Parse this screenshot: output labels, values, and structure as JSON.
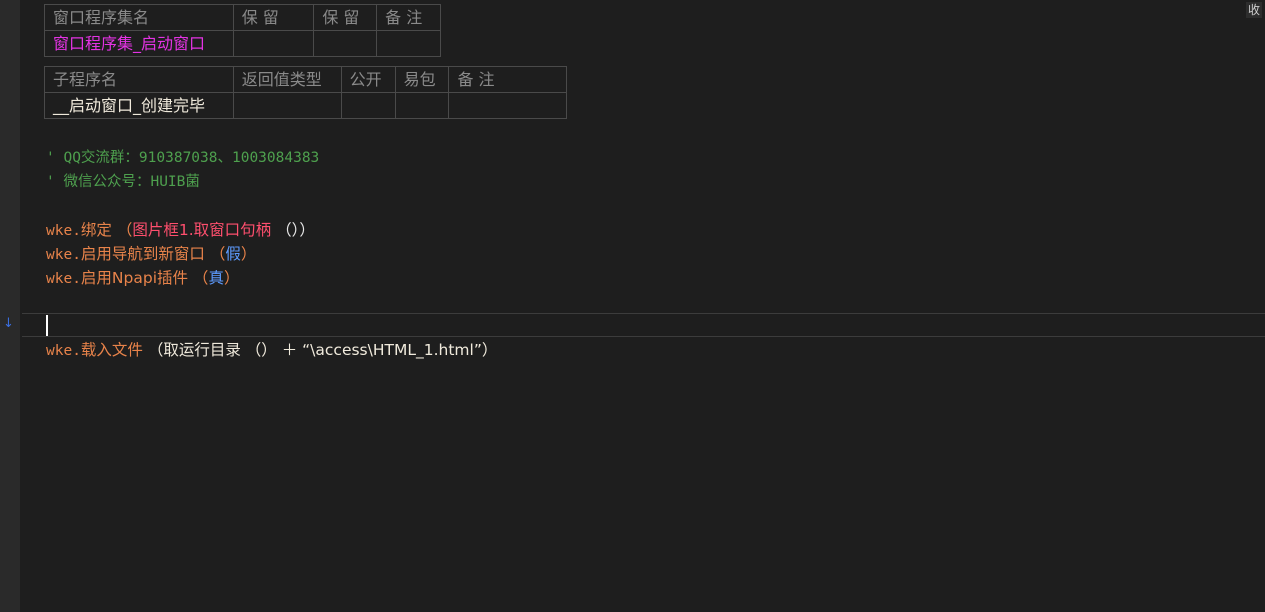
{
  "collapse_label": "收",
  "assembly_table": {
    "headers": [
      "窗口程序集名",
      "保 留",
      "保 留",
      "备 注"
    ],
    "row": [
      "窗口程序集_启动窗口",
      "",
      "",
      ""
    ]
  },
  "sub_table": {
    "headers": [
      "子程序名",
      "返回值类型",
      "公开",
      "易包",
      "备 注"
    ],
    "row": [
      "__启动窗口_创建完毕",
      "",
      "",
      "",
      ""
    ]
  },
  "comments": {
    "qq": "' QQ交流群：910387038、1003084383",
    "wechat": "' 微信公众号：HUIB菌"
  },
  "code": {
    "l1": {
      "obj": "wke.",
      "method": "绑定",
      "open": " （",
      "arg": "图片框1.取窗口句柄",
      "close": " （））"
    },
    "l2": {
      "obj": "wke.",
      "method": "启用导航到新窗口",
      "open": " （",
      "arg": "假",
      "close": "）"
    },
    "l3": {
      "obj": "wke.",
      "method": "启用Npapi插件",
      "open": " （",
      "arg": "真",
      "close": "）"
    },
    "l4": {
      "obj": "wke.",
      "method": "载入文件",
      "rest": " （取运行目录 （） ＋ “\\access\\HTML_1.html”）"
    }
  }
}
